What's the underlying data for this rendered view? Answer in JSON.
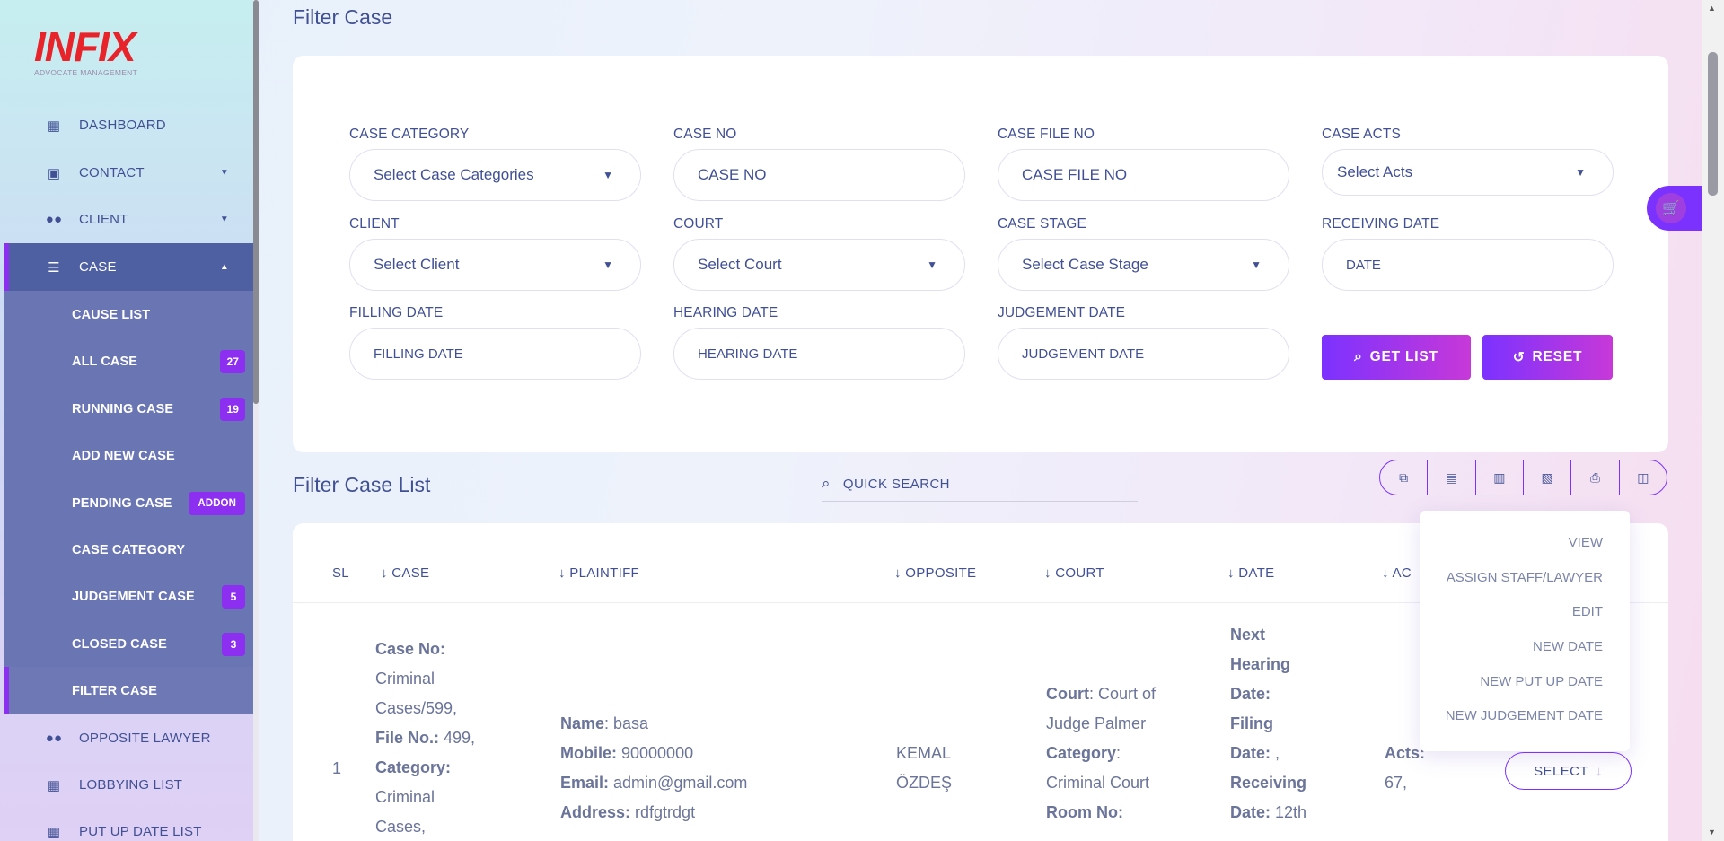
{
  "logo": {
    "main": "INFIX",
    "sub": "ADVOCATE MANAGEMENT"
  },
  "sidebar": {
    "items": [
      {
        "label": "DASHBOARD",
        "icon": "grid-icon"
      },
      {
        "label": "CONTACT",
        "icon": "contact-card-icon"
      },
      {
        "label": "CLIENT",
        "icon": "users-icon"
      },
      {
        "label": "CASE",
        "icon": "list-icon"
      }
    ],
    "case_sub": [
      {
        "label": "CAUSE LIST",
        "badge": ""
      },
      {
        "label": "ALL CASE",
        "badge": "27"
      },
      {
        "label": "RUNNING CASE",
        "badge": "19"
      },
      {
        "label": "ADD NEW CASE",
        "badge": ""
      },
      {
        "label": "PENDING CASE",
        "badge": "ADDON"
      },
      {
        "label": "CASE CATEGORY",
        "badge": ""
      },
      {
        "label": "JUDGEMENT CASE",
        "badge": "5"
      },
      {
        "label": "CLOSED CASE",
        "badge": "3"
      },
      {
        "label": "FILTER CASE",
        "badge": ""
      }
    ],
    "bottom": [
      {
        "label": "OPPOSITE LAWYER",
        "icon": "users-icon"
      },
      {
        "label": "LOBBYING LIST",
        "icon": "grid-icon"
      },
      {
        "label": "PUT UP DATE LIST",
        "icon": "grid-icon"
      }
    ]
  },
  "filter": {
    "title": "Filter Case",
    "fields": {
      "case_category": {
        "label": "CASE CATEGORY",
        "value": "Select Case Categories"
      },
      "case_no": {
        "label": "CASE NO",
        "placeholder": "CASE NO"
      },
      "case_file_no": {
        "label": "CASE FILE NO",
        "placeholder": "CASE FILE NO"
      },
      "case_acts": {
        "label": "CASE ACTS",
        "value": "Select Acts"
      },
      "client": {
        "label": "CLIENT",
        "value": "Select Client"
      },
      "court": {
        "label": "COURT",
        "value": "Select Court"
      },
      "case_stage": {
        "label": "CASE STAGE",
        "value": "Select Case Stage"
      },
      "receiving_date": {
        "label": "RECEIVING DATE",
        "placeholder": "DATE"
      },
      "filling_date": {
        "label": "FILLING DATE",
        "placeholder": "FILLING DATE"
      },
      "hearing_date": {
        "label": "HEARING DATE",
        "placeholder": "HEARING DATE"
      },
      "judgement_date": {
        "label": "JUDGEMENT DATE",
        "placeholder": "JUDGEMENT DATE"
      }
    },
    "get_list": "GET LIST",
    "reset": "RESET"
  },
  "list": {
    "title": "Filter Case List",
    "search_placeholder": "QUICK SEARCH",
    "export_icons": [
      "copy-icon",
      "excel-icon",
      "csv-icon",
      "pdf-icon",
      "print-icon",
      "columns-icon"
    ],
    "headers": [
      "SL",
      "CASE",
      "PLAINTIFF",
      "OPPOSITE",
      "COURT",
      "DATE",
      "AC"
    ],
    "row": {
      "sl": "1",
      "case_lines": [
        {
          "k": "Case No:",
          "v": ""
        },
        {
          "k": "",
          "v": "Criminal"
        },
        {
          "k": "",
          "v": "Cases/599,"
        },
        {
          "k": "File No.:",
          "v": " 499,"
        },
        {
          "k": "Category:",
          "v": ""
        },
        {
          "k": "",
          "v": "Criminal"
        },
        {
          "k": "",
          "v": "Cases,"
        }
      ],
      "plaintiff_lines": [
        {
          "k": "Name",
          "v": ": basa"
        },
        {
          "k": "Mobile:",
          "v": " 90000000"
        },
        {
          "k": "Email:",
          "v": " admin@gmail.com"
        },
        {
          "k": "Address:",
          "v": " rdfgtrdgt"
        }
      ],
      "opposite_lines": [
        "KEMAL",
        "ÖZDEŞ"
      ],
      "court_lines": [
        {
          "k": "Court",
          "v": ": Court of"
        },
        {
          "k": "",
          "v": "Judge Palmer"
        },
        {
          "k": "Category",
          "v": ":"
        },
        {
          "k": "",
          "v": "Criminal Court"
        },
        {
          "k": "Room No:",
          "v": ""
        }
      ],
      "date_lines": [
        {
          "k": "Next",
          "v": ""
        },
        {
          "k": "Hearing",
          "v": ""
        },
        {
          "k": "Date:",
          "v": ""
        },
        {
          "k": "Filing",
          "v": ""
        },
        {
          "k": "Date:",
          "v": " ,"
        },
        {
          "k": "Receiving",
          "v": ""
        },
        {
          "k": "Date:",
          "v": " 12th"
        }
      ],
      "acts_lines": [
        {
          "k": "Acts:",
          "v": ""
        },
        {
          "k": "",
          "v": "67,"
        }
      ]
    },
    "action_menu": [
      "VIEW",
      "ASSIGN STAFF/LAWYER",
      "EDIT",
      "NEW DATE",
      "NEW PUT UP DATE",
      "NEW JUDGEMENT DATE"
    ],
    "select_label": "SELECT"
  },
  "colors": {
    "accent": "#7c32ff",
    "nav_active": "#4e5fa2",
    "text": "#415094"
  }
}
